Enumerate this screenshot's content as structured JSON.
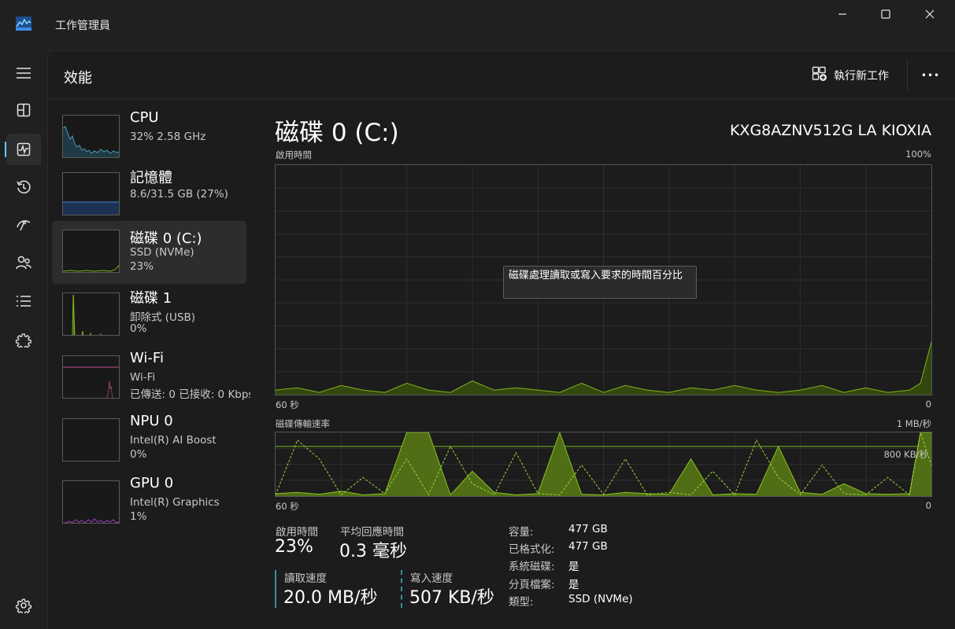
{
  "window": {
    "title": "工作管理員",
    "icon": "task-manager-icon"
  },
  "header": {
    "page_title": "效能",
    "run_new_task": "執行新工作",
    "more": "•••"
  },
  "rail": {
    "items": [
      "hamburger-icon",
      "processes-icon",
      "performance-icon",
      "app-history-icon",
      "startup-apps-icon",
      "users-icon",
      "details-icon",
      "services-icon"
    ],
    "active": "performance-icon",
    "settings": "settings-icon"
  },
  "devices": [
    {
      "name": "CPU",
      "line1": "32% 2.58 GHz",
      "line2": "",
      "color": "#4c9bb8"
    },
    {
      "name": "記憶體",
      "line1": "8.6/31.5 GB (27%)",
      "line2": "",
      "color": "#3f6fb0"
    },
    {
      "name": "磁碟 0 (C:)",
      "line1": "SSD (NVMe)",
      "line2": "23%",
      "color": "#7fb31a",
      "selected": true
    },
    {
      "name": "磁碟 1",
      "line1": "卸除式 (USB)",
      "line2": "0%",
      "color": "#7fb31a"
    },
    {
      "name": "Wi-Fi",
      "line1": "Wi-Fi",
      "line2": "已傳送: 0 已接收: 0 Kbps",
      "color": "#c0508c"
    },
    {
      "name": "NPU 0",
      "line1": "Intel(R) AI Boost",
      "line2": "0%",
      "color": "#888888"
    },
    {
      "name": "GPU 0",
      "line1": "Intel(R) Graphics",
      "line2": "1%",
      "color": "#a040c0"
    }
  ],
  "detail": {
    "title": "磁碟 0 (C:)",
    "model": "KXG8AZNV512G LA KIOXIA",
    "chart1": {
      "label": "啟用時間",
      "max_label": "100%",
      "left_label": "60 秒",
      "right_label": "0",
      "tooltip": "磁碟處理讀取或寫入要求的時間百分比"
    },
    "chart2": {
      "label": "磁碟傳輸速率",
      "max_label": "1 MB/秒",
      "ref_label": "800 KB/秒",
      "left_label": "60 秒",
      "right_label": "0"
    },
    "stats": {
      "active_time_label": "啟用時間",
      "active_time_value": "23%",
      "avg_response_label": "平均回應時間",
      "avg_response_value": "0.3 毫秒",
      "read_label": "讀取速度",
      "read_value": "20.0 MB/秒",
      "write_label": "寫入速度",
      "write_value": "507 KB/秒"
    },
    "properties": [
      {
        "key": "容量:",
        "value": "477 GB"
      },
      {
        "key": "已格式化:",
        "value": "477 GB"
      },
      {
        "key": "系統磁碟:",
        "value": "是"
      },
      {
        "key": "分頁檔案:",
        "value": "是"
      },
      {
        "key": "類型:",
        "value": "SSD (NVMe)"
      }
    ]
  },
  "chart_data": [
    {
      "type": "area",
      "title": "啟用時間",
      "ylim": [
        0,
        100
      ],
      "xlabel": "60 秒",
      "x": [
        60,
        58,
        56,
        54,
        52,
        50,
        48,
        46,
        44,
        42,
        40,
        38,
        36,
        34,
        32,
        30,
        28,
        26,
        24,
        22,
        20,
        18,
        16,
        14,
        12,
        10,
        8,
        6,
        4,
        2,
        1,
        0
      ],
      "series": [
        {
          "values": [
            2,
            3,
            1,
            4,
            2,
            1,
            5,
            2,
            1,
            6,
            2,
            3,
            2,
            1,
            5,
            1,
            4,
            2,
            1,
            3,
            2,
            4,
            2,
            1,
            2,
            4,
            1,
            3,
            1,
            2,
            5,
            23
          ]
        }
      ]
    },
    {
      "type": "area",
      "title": "磁碟傳輸速率",
      "ylim": [
        0,
        1024
      ],
      "ylabel": "KB/秒",
      "x": [
        60,
        58,
        56,
        54,
        52,
        50,
        48,
        46,
        44,
        42,
        40,
        38,
        36,
        34,
        32,
        30,
        28,
        26,
        24,
        22,
        20,
        18,
        16,
        14,
        12,
        10,
        8,
        6,
        4,
        2,
        1,
        0
      ],
      "series": [
        {
          "values": [
            40,
            60,
            30,
            80,
            20,
            40,
            1024,
            1024,
            20,
            400,
            60,
            20,
            40,
            1024,
            30,
            20,
            60,
            40,
            30,
            600,
            20,
            40,
            30,
            800,
            60,
            30,
            200,
            40,
            30,
            40,
            1024,
            1024
          ]
        },
        {
          "values": [
            20,
            900,
            600,
            20,
            300,
            40,
            600,
            20,
            800,
            200,
            20,
            700,
            40,
            20,
            500,
            30,
            600,
            20,
            60,
            20,
            400,
            20,
            900,
            300,
            20,
            500,
            40,
            20,
            300,
            20,
            1024,
            500
          ]
        }
      ]
    }
  ]
}
